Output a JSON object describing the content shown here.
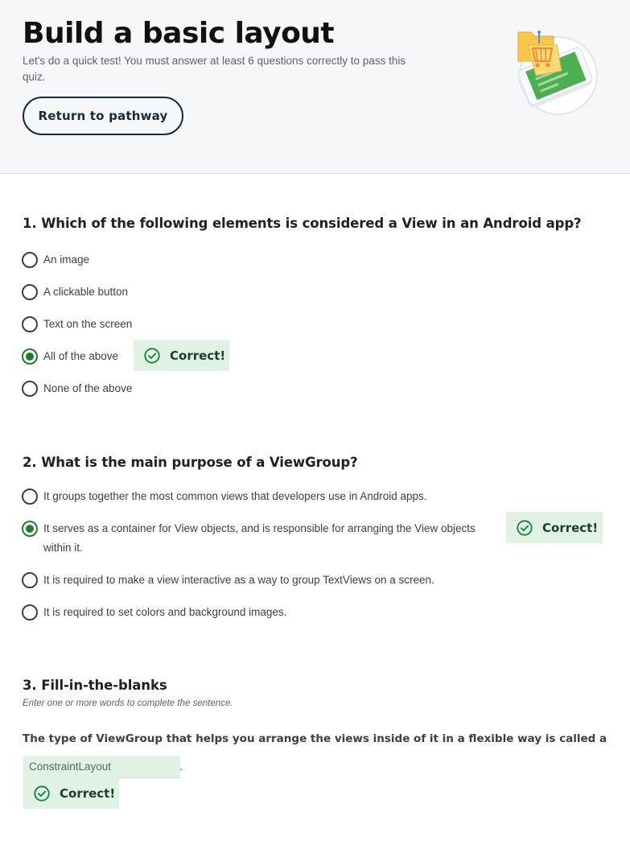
{
  "header": {
    "title": "Build a basic layout",
    "description": "Let's do a quick test! You must answer at least 6 questions correctly to pass this quiz.",
    "return_label": "Return to pathway"
  },
  "questions": [
    {
      "title": "1. Which of the following elements is considered a View in an Android app?",
      "options": [
        {
          "label": "An image",
          "selected": false
        },
        {
          "label": "A clickable button",
          "selected": false
        },
        {
          "label": "Text on the screen",
          "selected": false
        },
        {
          "label": "All of the above",
          "selected": true
        },
        {
          "label": "None of the above",
          "selected": false
        }
      ],
      "feedback": "Correct!"
    },
    {
      "title": "2. What is the main purpose of a ViewGroup?",
      "options": [
        {
          "label": "It groups together the most common views that developers use in Android apps.",
          "selected": false
        },
        {
          "label": "It serves as a container for View objects, and is responsible for arranging the View objects within it.",
          "selected": true
        },
        {
          "label": "It is required to make a view interactive as a way to group TextViews on a screen.",
          "selected": false
        },
        {
          "label": "It is required to set colors and background images.",
          "selected": false
        }
      ],
      "feedback": "Correct!"
    },
    {
      "title": "3. Fill-in-the-blanks",
      "hint": "Enter one or more words to complete the sentence.",
      "sentence": "The type of ViewGroup that helps you arrange the views inside of it in a flexible way is called a",
      "answer_value": "ConstraintLayout",
      "period": ".",
      "feedback": "Correct!"
    }
  ],
  "colors": {
    "header_bg": "#f6f7f9",
    "correct_bg": "#e0f2e3",
    "radio_selected": "#1e7d32",
    "check_icon": "#188038"
  },
  "icons": {
    "feedback": "check-circle-icon",
    "illustration": "shopping-cart-phone-illustration"
  }
}
